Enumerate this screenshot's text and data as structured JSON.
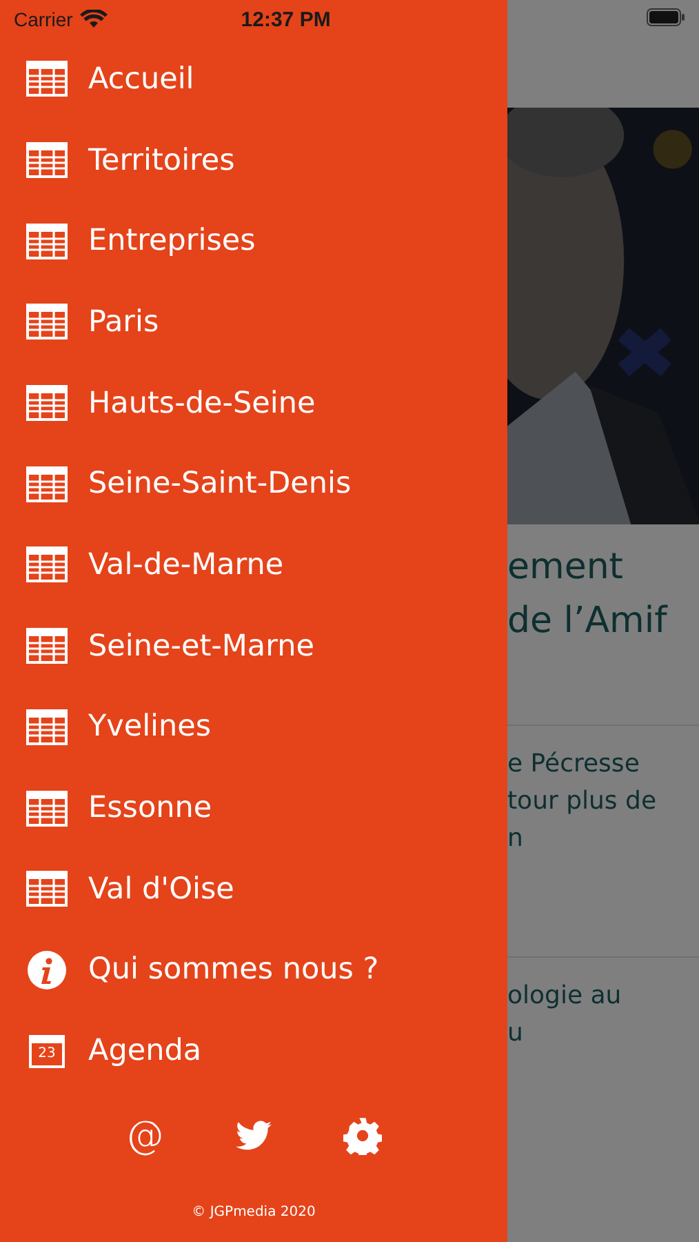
{
  "status_bar": {
    "carrier": "Carrier",
    "time": "12:37 PM"
  },
  "menu": [
    {
      "kind": "grid",
      "label": "Accueil"
    },
    {
      "kind": "grid",
      "label": "Territoires"
    },
    {
      "kind": "grid",
      "label": "Entreprises"
    },
    {
      "kind": "grid",
      "label": "Paris"
    },
    {
      "kind": "grid",
      "label": "Hauts-de-Seine"
    },
    {
      "kind": "grid",
      "label": "Seine-Saint-Denis"
    },
    {
      "kind": "grid",
      "label": "Val-de-Marne"
    },
    {
      "kind": "grid",
      "label": "Seine-et-Marne"
    },
    {
      "kind": "grid",
      "label": "Yvelines"
    },
    {
      "kind": "grid",
      "label": "Essonne"
    },
    {
      "kind": "grid",
      "label": "Val d'Oise"
    },
    {
      "kind": "info",
      "label": "Qui sommes nous ?"
    },
    {
      "kind": "calendar",
      "label": "Agenda",
      "day": "23"
    }
  ],
  "footer": {
    "email_glyph": "@",
    "copyright": "© JGPmedia 2020"
  },
  "background_page": {
    "picture": {
      "kind": "picture"
    },
    "headline": [
      "ement",
      "de l’Amif"
    ],
    "articles": [
      {
        "lines": [
          "e Pécresse",
          "tour plus de",
          "n"
        ]
      },
      {
        "lines": [
          "ologie au",
          "u"
        ]
      }
    ]
  }
}
